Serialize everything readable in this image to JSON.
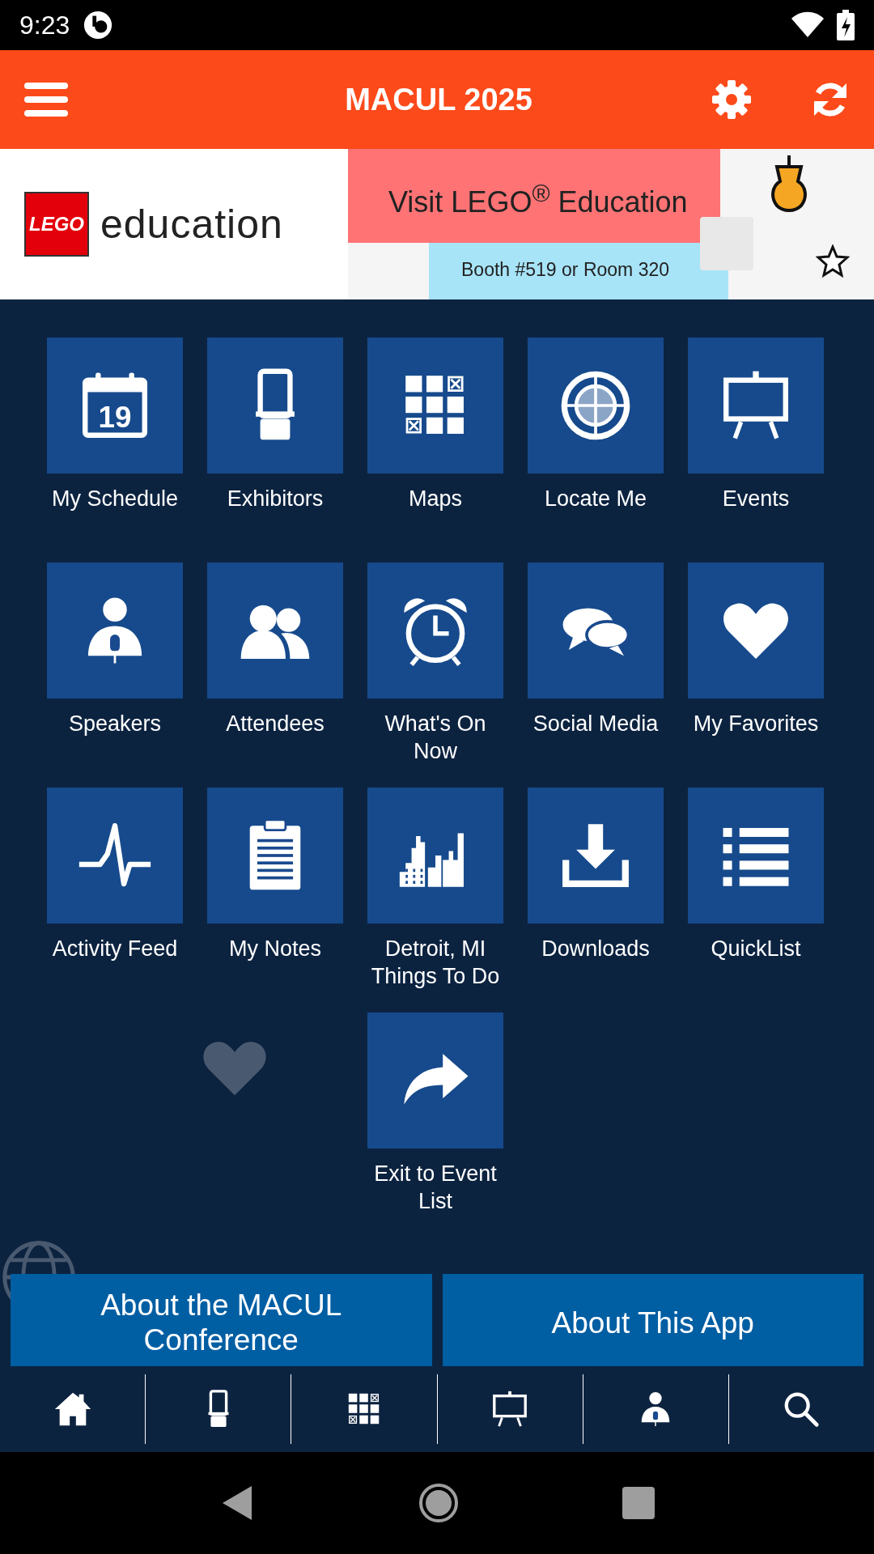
{
  "status_bar": {
    "time": "9:23"
  },
  "header": {
    "title": "MACUL 2025"
  },
  "banner": {
    "logo_box": "LEGO",
    "logo_word": "education",
    "headline": "Visit LEGO$^{®}$ Education",
    "subline": "Booth #519 or Room 320"
  },
  "tiles": [
    {
      "label": "My Schedule",
      "number": "19"
    },
    {
      "label": "Exhibitors"
    },
    {
      "label": "Maps"
    },
    {
      "label": "Locate Me"
    },
    {
      "label": "Events"
    },
    {
      "label": "Speakers"
    },
    {
      "label": "Attendees"
    },
    {
      "label": "What's On Now"
    },
    {
      "label": "Social Media"
    },
    {
      "label": "My Favorites"
    },
    {
      "label": "Activity Feed"
    },
    {
      "label": "My Notes"
    },
    {
      "label": "Detroit, MI Things To Do"
    },
    {
      "label": "Downloads"
    },
    {
      "label": "QuickList"
    },
    {
      "label": "Exit to Event List"
    }
  ],
  "buttons": [
    "About the MACUL Conference",
    "About This App"
  ],
  "bottom_nav": [
    {
      "kind": "home"
    },
    {
      "kind": "exhibitors"
    },
    {
      "kind": "maps"
    },
    {
      "kind": "events"
    },
    {
      "kind": "speakers"
    },
    {
      "kind": "search"
    }
  ]
}
